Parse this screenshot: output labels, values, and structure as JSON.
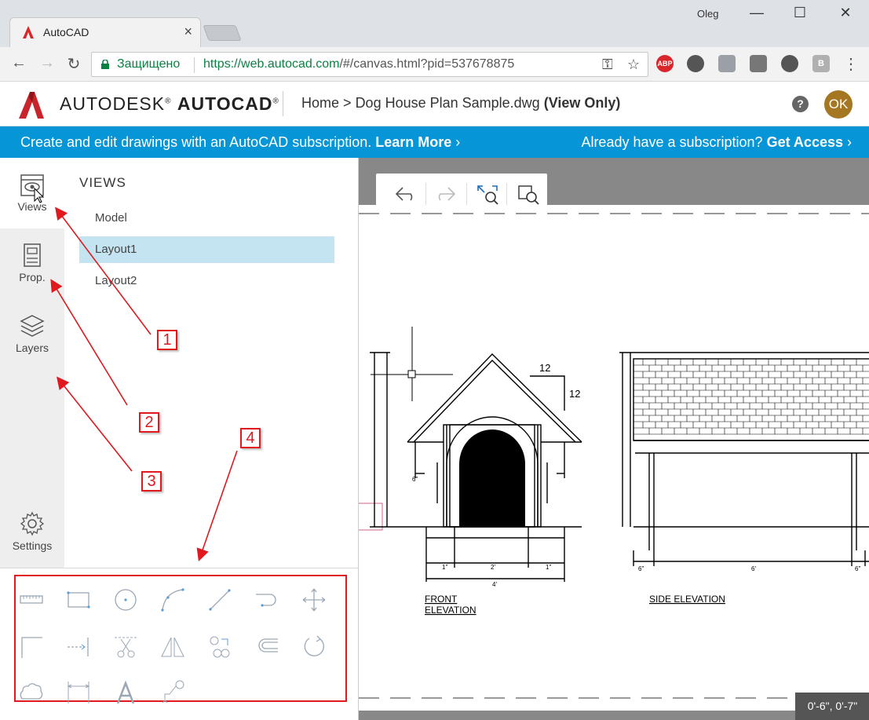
{
  "browser": {
    "tab_title": "AutoCAD",
    "tab_close": "×",
    "user_name": "Oleg",
    "minimize": "—",
    "maximize": "☐",
    "close": "✕",
    "back": "←",
    "forward": "→",
    "reload": "↻",
    "secure_label": "Защищено",
    "url_host": "https://web.autocad.com",
    "url_path": "/#/canvas.html?pid=537678875",
    "key_icon": "⚿",
    "star_icon": "☆",
    "extensions": [
      {
        "name": "adblock-plus-icon",
        "label": "ABP",
        "color": "#d8262b"
      },
      {
        "name": "film-reel-icon",
        "label": "",
        "color": "#555555"
      },
      {
        "name": "shield-v-icon",
        "label": "",
        "color": "#9aa0a6"
      },
      {
        "name": "window-icon",
        "label": "",
        "color": "#777777"
      },
      {
        "name": "gear-extension-icon",
        "label": "",
        "color": "#555555"
      },
      {
        "name": "b-extension-icon",
        "label": "B",
        "color": "#b0b0b0"
      }
    ],
    "menu_icon": "⋮"
  },
  "app": {
    "brand_light": "AUTODESK",
    "brand_reg": "®",
    "brand_bold": "AUTOCAD",
    "breadcrumb_home": "Home",
    "breadcrumb_sep": ">",
    "file_name": "Dog House Plan Sample.dwg",
    "view_only": "(View Only)",
    "help_label": "?",
    "user_initials": "OK",
    "accent_color": "#0696d7"
  },
  "banner": {
    "text": "Create and edit drawings with an AutoCAD subscription.",
    "learn_more": "Learn More",
    "right_text": "Already have a subscription?",
    "get_access": "Get Access"
  },
  "rail": {
    "views": "Views",
    "props": "Prop.",
    "layers": "Layers",
    "settings": "Settings"
  },
  "views_panel": {
    "title": "VIEWS",
    "items": [
      "Model",
      "Layout1",
      "Layout2"
    ],
    "selected": "Layout1"
  },
  "drawing": {
    "pitch_top": "12",
    "pitch_side": "12",
    "front_label_1": "FRONT",
    "front_label_2": "ELEVATION",
    "side_label": "SIDE ELEVATION",
    "dim_1": "1\"",
    "dim_2": "2'",
    "dim_3": "1\"",
    "dim_4": "4'",
    "dim_5": "6\"",
    "dim_6": "6'",
    "dim_7": "6\"",
    "dim_8": "6\"",
    "dim_9": "6\""
  },
  "status": {
    "coords": "0'-6\", 0'-7\""
  },
  "callouts": [
    "1",
    "2",
    "3",
    "4"
  ]
}
